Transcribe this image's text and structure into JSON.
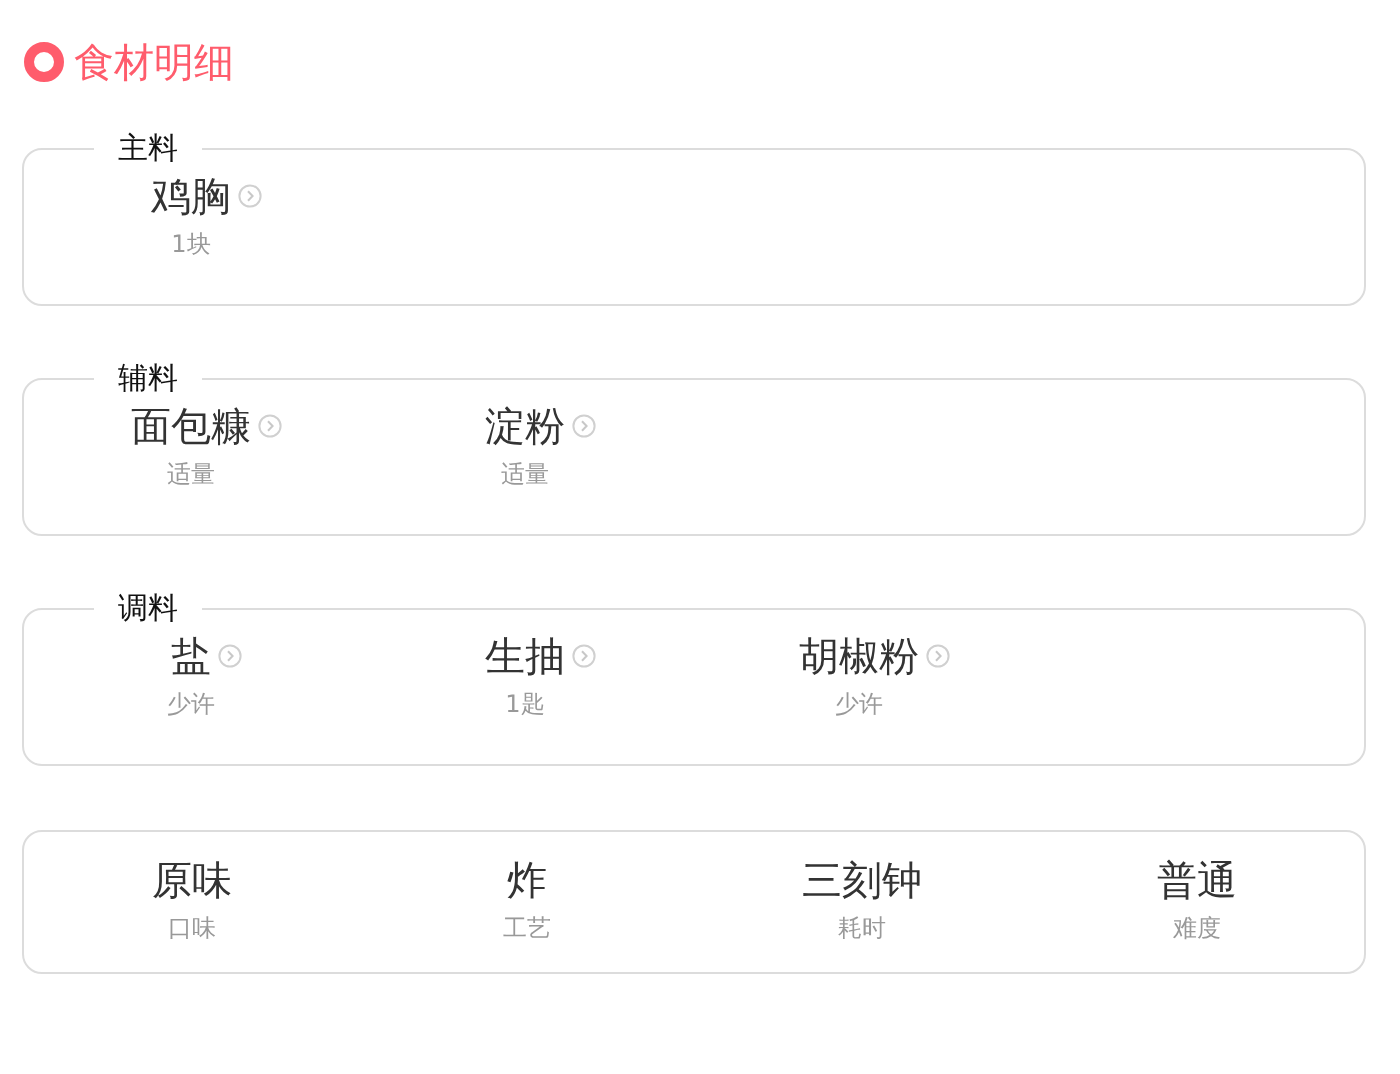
{
  "title": "食材明细",
  "groups": [
    {
      "label": "主料",
      "items": [
        {
          "name": "鸡胸",
          "amount": "1块"
        }
      ]
    },
    {
      "label": "辅料",
      "items": [
        {
          "name": "面包糠",
          "amount": "适量"
        },
        {
          "name": "淀粉",
          "amount": "适量"
        }
      ]
    },
    {
      "label": "调料",
      "items": [
        {
          "name": "盐",
          "amount": "少许"
        },
        {
          "name": "生抽",
          "amount": "1匙"
        },
        {
          "name": "胡椒粉",
          "amount": "少许"
        }
      ]
    }
  ],
  "summary": [
    {
      "value": "原味",
      "label": "口味"
    },
    {
      "value": "炸",
      "label": "工艺"
    },
    {
      "value": "三刻钟",
      "label": "耗时"
    },
    {
      "value": "普通",
      "label": "难度"
    }
  ]
}
